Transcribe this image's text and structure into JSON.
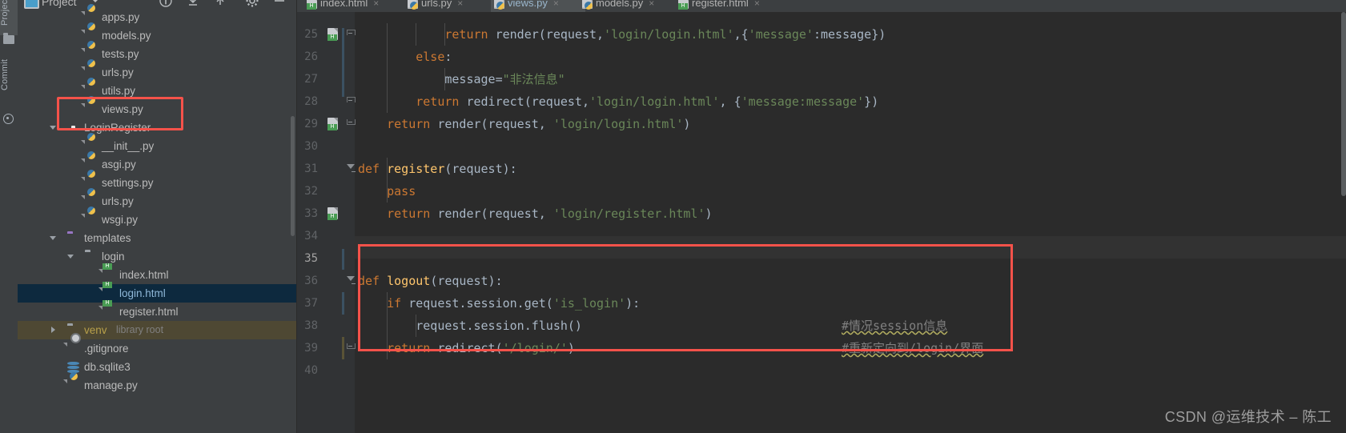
{
  "app": {
    "name": "PyCharm",
    "theme": "darcula",
    "accent_highlight": "#f5524a",
    "selection_color": "#0d293e"
  },
  "left_strip": {
    "tabs": [
      {
        "label": "Project",
        "icon": "project-folder-icon",
        "active": true
      },
      {
        "label": "Commit",
        "icon": "commit-icon",
        "active": false
      }
    ]
  },
  "project_panel": {
    "title": "Project",
    "toolbar_icons": [
      "info-icon",
      "collapse-all-icon",
      "expand-all-icon",
      "settings-gear-icon",
      "hide-icon"
    ],
    "tree": [
      {
        "label": "apps.py",
        "icon": "python-file-icon",
        "indent": 3,
        "state": "none"
      },
      {
        "label": "models.py",
        "icon": "python-file-icon",
        "indent": 3,
        "state": "none"
      },
      {
        "label": "tests.py",
        "icon": "python-file-icon",
        "indent": 3,
        "state": "none"
      },
      {
        "label": "urls.py",
        "icon": "python-file-icon",
        "indent": 3,
        "state": "none"
      },
      {
        "label": "utils.py",
        "icon": "python-file-icon",
        "indent": 3,
        "state": "none"
      },
      {
        "label": "views.py",
        "icon": "python-file-icon",
        "indent": 3,
        "state": "highlighted"
      },
      {
        "label": "LoginRegister",
        "icon": "module-icon",
        "indent": 2,
        "state": "expanded"
      },
      {
        "label": "__init__.py",
        "icon": "python-file-icon",
        "indent": 3,
        "state": "none"
      },
      {
        "label": "asgi.py",
        "icon": "python-file-icon",
        "indent": 3,
        "state": "none"
      },
      {
        "label": "settings.py",
        "icon": "python-file-icon",
        "indent": 3,
        "state": "none"
      },
      {
        "label": "urls.py",
        "icon": "python-file-icon",
        "indent": 3,
        "state": "none"
      },
      {
        "label": "wsgi.py",
        "icon": "python-file-icon",
        "indent": 3,
        "state": "none"
      },
      {
        "label": "templates",
        "icon": "folder-purple-icon",
        "indent": 2,
        "state": "expanded"
      },
      {
        "label": "login",
        "icon": "folder-icon",
        "indent": 3,
        "state": "expanded"
      },
      {
        "label": "index.html",
        "icon": "html-file-icon",
        "indent": 4,
        "state": "none"
      },
      {
        "label": "login.html",
        "icon": "html-file-icon",
        "indent": 4,
        "state": "selected"
      },
      {
        "label": "register.html",
        "icon": "html-file-icon",
        "indent": 4,
        "state": "none"
      },
      {
        "label": "venv",
        "icon": "folder-icon",
        "indent": 2,
        "state": "collapsed",
        "suffix": "library root"
      },
      {
        "label": ".gitignore",
        "icon": "gitignore-file-icon",
        "indent": 2,
        "state": "none"
      },
      {
        "label": "db.sqlite3",
        "icon": "database-icon",
        "indent": 2,
        "state": "none"
      },
      {
        "label": "manage.py",
        "icon": "python-file-icon",
        "indent": 2,
        "state": "none"
      }
    ]
  },
  "editor": {
    "tabs": [
      {
        "label": "index.html",
        "icon": "html-file-icon",
        "active": false
      },
      {
        "label": "urls.py",
        "icon": "python-file-icon",
        "active": false
      },
      {
        "label": "views.py",
        "icon": "python-file-icon",
        "active": true
      },
      {
        "label": "models.py",
        "icon": "python-file-icon",
        "active": false
      },
      {
        "label": "register.html",
        "icon": "html-file-icon",
        "active": false
      }
    ],
    "close_glyph": "×",
    "current_line": 35,
    "lines": [
      {
        "num": 25,
        "indent": 12,
        "gutter_icon": "html-marker-icon",
        "fold": "cap",
        "tokens": [
          {
            "t": "return ",
            "c": "kw"
          },
          {
            "t": "render(request,",
            "c": "pl"
          },
          {
            "t": "'login/login.html'",
            "c": "str"
          },
          {
            "t": ",{",
            "c": "pl"
          },
          {
            "t": "'message'",
            "c": "str"
          },
          {
            "t": ":message}",
            "c": "pl"
          },
          {
            "t": ")",
            "c": "pl"
          }
        ]
      },
      {
        "num": 26,
        "indent": 8,
        "tokens": [
          {
            "t": "else",
            "c": "kw"
          },
          {
            "t": ":",
            "c": "pl"
          }
        ]
      },
      {
        "num": 27,
        "indent": 12,
        "tokens": [
          {
            "t": "message=",
            "c": "pl"
          },
          {
            "t": "\"非法信息\"",
            "c": "str"
          }
        ]
      },
      {
        "num": 28,
        "indent": 8,
        "fold": "cap",
        "tokens": [
          {
            "t": "return ",
            "c": "kw"
          },
          {
            "t": "redirect(request,",
            "c": "pl"
          },
          {
            "t": "'login/login.html'",
            "c": "str"
          },
          {
            "t": ", {",
            "c": "pl"
          },
          {
            "t": "'message:message'",
            "c": "str"
          },
          {
            "t": "})",
            "c": "pl"
          }
        ]
      },
      {
        "num": 29,
        "indent": 4,
        "gutter_icon": "html-marker-icon",
        "fold": "capend",
        "tokens": [
          {
            "t": "return ",
            "c": "kw"
          },
          {
            "t": "render(request, ",
            "c": "pl"
          },
          {
            "t": "'login/login.html'",
            "c": "str"
          },
          {
            "t": ")",
            "c": "pl"
          }
        ]
      },
      {
        "num": 30,
        "indent": 0,
        "tokens": []
      },
      {
        "num": 31,
        "indent": 0,
        "fold": "tri",
        "tokens": [
          {
            "t": "def ",
            "c": "kw"
          },
          {
            "t": "register",
            "c": "fn"
          },
          {
            "t": "(request):",
            "c": "pl"
          }
        ]
      },
      {
        "num": 32,
        "indent": 4,
        "tokens": [
          {
            "t": "pass",
            "c": "kw"
          }
        ]
      },
      {
        "num": 33,
        "indent": 4,
        "gutter_icon": "html-marker-icon",
        "tokens": [
          {
            "t": "return ",
            "c": "kw"
          },
          {
            "t": "render(request, ",
            "c": "pl"
          },
          {
            "t": "'login/register.html'",
            "c": "str"
          },
          {
            "t": ")",
            "c": "pl"
          }
        ]
      },
      {
        "num": 34,
        "indent": 0,
        "tokens": []
      },
      {
        "num": 35,
        "indent": 0,
        "tokens": [],
        "current": true
      },
      {
        "num": 36,
        "indent": 0,
        "fold": "tri",
        "tokens": [
          {
            "t": "def ",
            "c": "kw"
          },
          {
            "t": "logout",
            "c": "fn"
          },
          {
            "t": "(request):",
            "c": "pl"
          }
        ]
      },
      {
        "num": 37,
        "indent": 4,
        "tokens": [
          {
            "t": "if ",
            "c": "kw"
          },
          {
            "t": "request.session.get(",
            "c": "pl"
          },
          {
            "t": "'is_login'",
            "c": "str"
          },
          {
            "t": "):",
            "c": "pl"
          }
        ]
      },
      {
        "num": 38,
        "indent": 8,
        "tokens": [
          {
            "t": "request.session.flush()",
            "c": "pl"
          }
        ],
        "comment": "#情况session信息"
      },
      {
        "num": 39,
        "indent": 4,
        "fold": "capend",
        "tokens": [
          {
            "t": "return ",
            "c": "kw"
          },
          {
            "t": "redirect(",
            "c": "pl"
          },
          {
            "t": "'/login/'",
            "c": "str"
          },
          {
            "t": ")",
            "c": "pl"
          }
        ],
        "comment": "#重新定向到/login/界面"
      },
      {
        "num": 40,
        "indent": 0,
        "tokens": []
      }
    ]
  },
  "watermark": "CSDN @运维技术 – 陈工"
}
